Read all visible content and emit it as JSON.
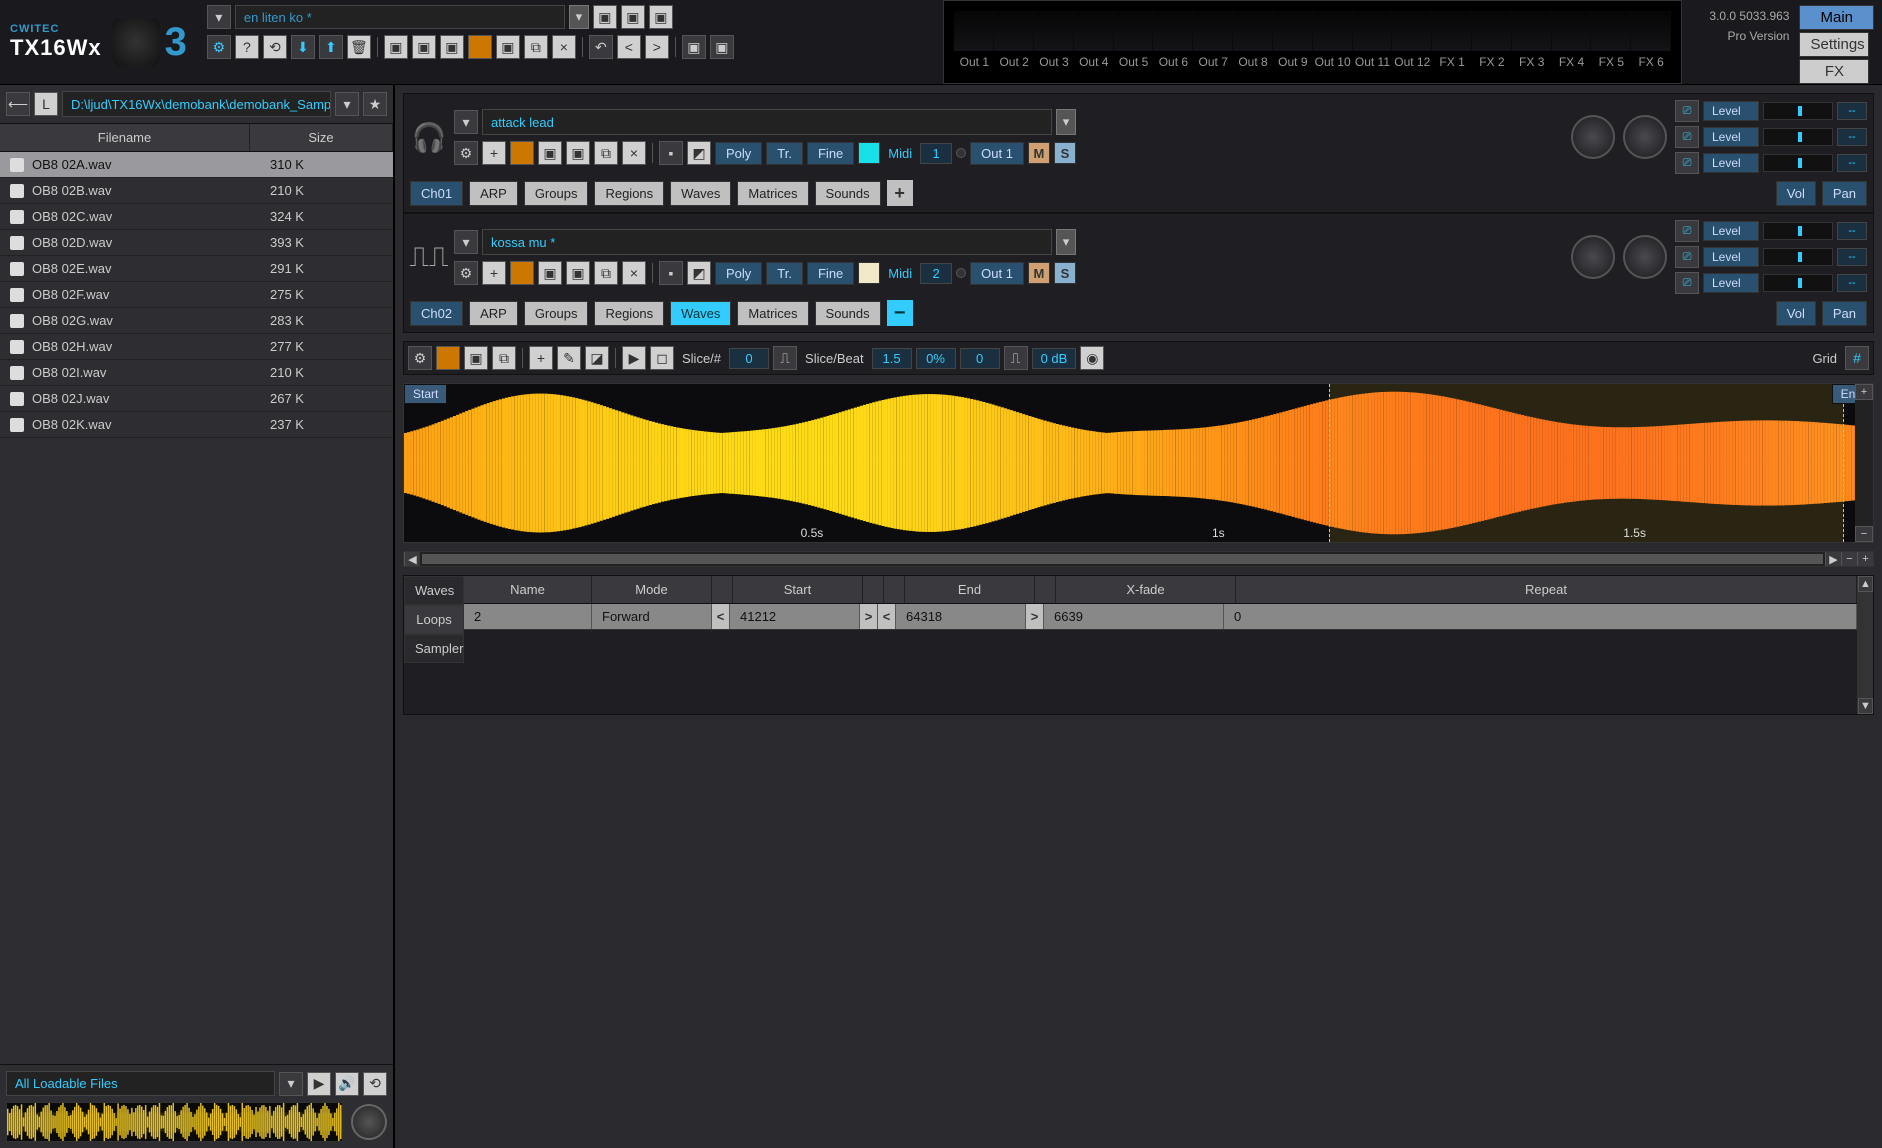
{
  "app": {
    "brand": "CWITEC",
    "product": "TX16Wx",
    "version_suffix": "3"
  },
  "header": {
    "performance_name": "en liten ko *",
    "version": "3.0.0 5033.963",
    "edition": "Pro Version",
    "nav": {
      "main": "Main",
      "settings": "Settings",
      "fx": "FX"
    },
    "outputs": [
      "Out 1",
      "Out 2",
      "Out 3",
      "Out 4",
      "Out 5",
      "Out 6",
      "Out 7",
      "Out 8",
      "Out 9",
      "Out 10",
      "Out 11",
      "Out 12",
      "FX 1",
      "FX 2",
      "FX 3",
      "FX 4",
      "FX 5",
      "FX 6"
    ]
  },
  "browser": {
    "path": "D:\\ljud\\TX16Wx\\demobank\\demobank_Samp",
    "columns": {
      "filename": "Filename",
      "size": "Size"
    },
    "files": [
      {
        "name": "OB8 02A.wav",
        "size": "310 K",
        "selected": true
      },
      {
        "name": "OB8 02B.wav",
        "size": "210 K"
      },
      {
        "name": "OB8 02C.wav",
        "size": "324 K"
      },
      {
        "name": "OB8 02D.wav",
        "size": "393 K"
      },
      {
        "name": "OB8 02E.wav",
        "size": "291 K"
      },
      {
        "name": "OB8 02F.wav",
        "size": "275 K"
      },
      {
        "name": "OB8 02G.wav",
        "size": "283 K"
      },
      {
        "name": "OB8 02H.wav",
        "size": "277 K"
      },
      {
        "name": "OB8 02I.wav",
        "size": "210 K"
      },
      {
        "name": "OB8 02J.wav",
        "size": "267 K"
      },
      {
        "name": "OB8 02K.wav",
        "size": "237 K"
      }
    ],
    "filter": "All Loadable Files"
  },
  "channels": [
    {
      "id": "Ch01",
      "name": "attack lead",
      "poly": "Poly",
      "tr": "Tr.",
      "fine": "Fine",
      "midi_label": "Midi",
      "midi_ch": "1",
      "out": "Out 1",
      "color": "#18e0e8",
      "tabs": [
        "ARP",
        "Groups",
        "Regions",
        "Waves",
        "Matrices",
        "Sounds"
      ],
      "active_tab": null,
      "vol": "Vol",
      "pan": "Pan",
      "levels": [
        "Level",
        "Level",
        "Level"
      ],
      "level_vals": [
        "--",
        "--",
        "--"
      ]
    },
    {
      "id": "Ch02",
      "name": "kossa mu *",
      "poly": "Poly",
      "tr": "Tr.",
      "fine": "Fine",
      "midi_label": "Midi",
      "midi_ch": "2",
      "out": "Out 1",
      "color": "#f0e8c8",
      "tabs": [
        "ARP",
        "Groups",
        "Regions",
        "Waves",
        "Matrices",
        "Sounds"
      ],
      "active_tab": "Waves",
      "vol": "Vol",
      "pan": "Pan",
      "levels": [
        "Level",
        "Level",
        "Level"
      ],
      "level_vals": [
        "--",
        "--",
        "--"
      ]
    }
  ],
  "wave_toolbar": {
    "slice_num_label": "Slice/#",
    "slice_num": "0",
    "slice_beat_label": "Slice/Beat",
    "slice_beat": "1.5",
    "percent": "0%",
    "offset": "0",
    "db": "0 dB",
    "grid_label": "Grid"
  },
  "wave_view": {
    "start_label": "Start",
    "end_label": "End",
    "time_marks": [
      "0.5s",
      "1s",
      "1.5s"
    ]
  },
  "loop_table": {
    "tabs": [
      "Waves",
      "Loops",
      "Sampler"
    ],
    "active_tab": "Loops",
    "columns": [
      "Name",
      "Mode",
      "Start",
      "End",
      "X-fade",
      "Repeat"
    ],
    "row": {
      "name": "2",
      "mode": "Forward",
      "start": "41212",
      "end": "64318",
      "xfade": "6639",
      "repeat": "0"
    }
  },
  "icons": {
    "gear": "⚙",
    "help": "?",
    "loop": "⟲",
    "down": "⬇",
    "up": "⬆",
    "trash": "🗑",
    "left": "◀",
    "right": "▶",
    "x": "×",
    "plus": "+",
    "minus": "−",
    "play": "▶",
    "vol": "🔊",
    "star": "★",
    "folder": "📁",
    "save": "▣",
    "copy": "⧉",
    "dropdown": "▾",
    "sliders": "⎚",
    "grid": "#",
    "lt": "<",
    "gt": ">",
    "headphones": "🎧",
    "spectrum": "⎍"
  }
}
